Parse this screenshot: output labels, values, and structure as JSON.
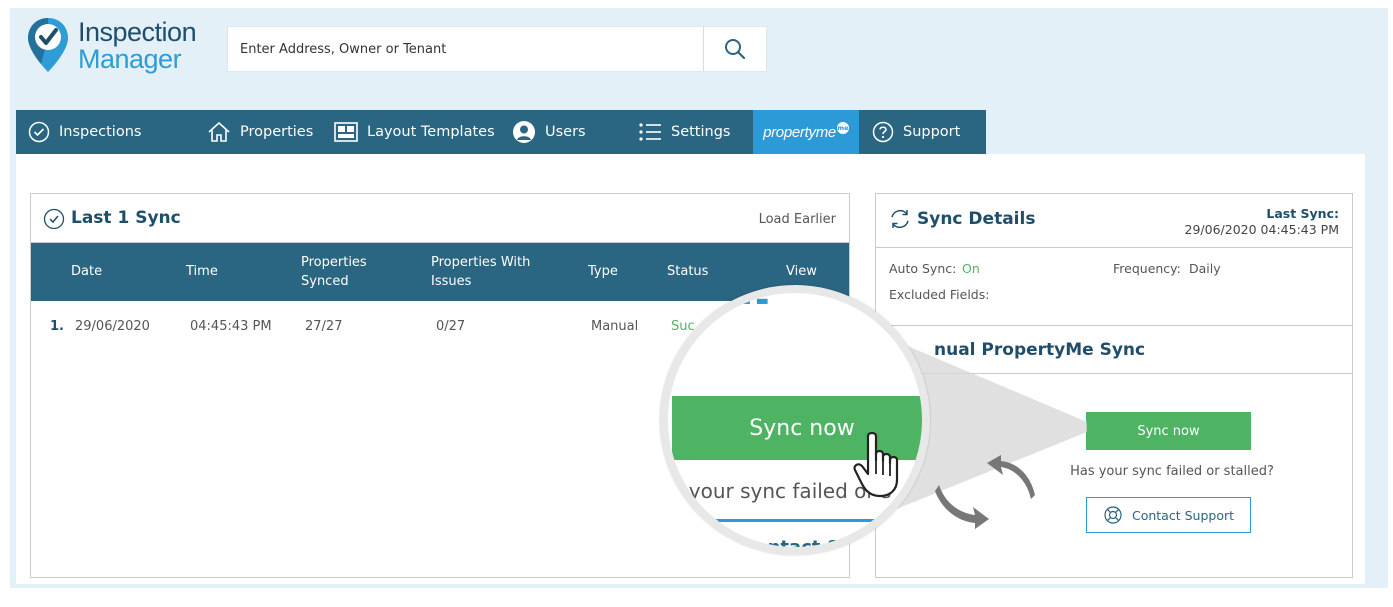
{
  "app": {
    "logo_line1": "Inspection",
    "logo_line2": "Manager"
  },
  "search": {
    "placeholder": "Enter Address, Owner or Tenant",
    "icon": "search-icon"
  },
  "nav": {
    "items": [
      {
        "label": "Inspections",
        "icon": "check-circle-icon"
      },
      {
        "label": "Properties",
        "icon": "home-icon"
      },
      {
        "label": "Layout Templates",
        "icon": "layout-icon"
      },
      {
        "label": "Users",
        "icon": "user-icon"
      },
      {
        "label": "Settings",
        "icon": "list-icon"
      },
      {
        "label": "propertyme",
        "badge": "me",
        "icon": "propertyme-logo",
        "active": true
      },
      {
        "label": "Support",
        "icon": "question-icon"
      }
    ]
  },
  "last_sync": {
    "title": "Last 1 Sync",
    "load_earlier": "Load Earlier",
    "columns": {
      "date": "Date",
      "time": "Time",
      "properties_synced_1": "Properties",
      "properties_synced_2": "Synced",
      "properties_issues_1": "Properties With",
      "properties_issues_2": "Issues",
      "type": "Type",
      "status": "Status",
      "view": "View"
    },
    "rows": [
      {
        "index": "1.",
        "date": "29/06/2020",
        "time": "04:45:43 PM",
        "synced": "27/27",
        "issues": "0/27",
        "type": "Manual",
        "status": "Suc"
      }
    ]
  },
  "sync_details": {
    "title": "Sync Details",
    "last_sync_label": "Last Sync:",
    "last_sync_value": "29/06/2020 04:45:43 PM",
    "auto_sync_label": "Auto Sync:",
    "auto_sync_value": "On",
    "frequency_label": "Frequency:",
    "frequency_value": "Daily",
    "excluded_label": "Excluded Fields:",
    "manual_title": "nual PropertyMe Sync",
    "sync_button": "Sync now",
    "failed_text": "Has your sync failed or stalled?",
    "contact_button": "Contact Support"
  },
  "magnifier": {
    "sync_button": "Sync now",
    "failed_text": "s your sync failed or s",
    "contact_text": "Contact S"
  },
  "colors": {
    "nav_bg": "#2a6581",
    "nav_active": "#2c9ad7",
    "green": "#4eb464",
    "title": "#1f4e6b"
  }
}
